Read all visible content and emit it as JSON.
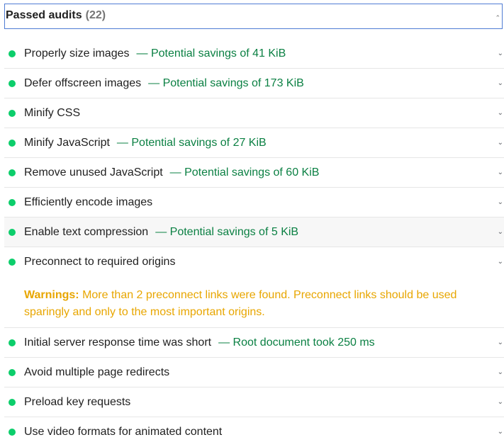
{
  "header": {
    "title": "Passed audits",
    "count": "(22)"
  },
  "audits": [
    {
      "label": "Properly size images",
      "savings": "— Potential savings of 41 KiB"
    },
    {
      "label": "Defer offscreen images",
      "savings": "— Potential savings of 173 KiB"
    },
    {
      "label": "Minify CSS",
      "savings": ""
    },
    {
      "label": "Minify JavaScript",
      "savings": "— Potential savings of 27 KiB"
    },
    {
      "label": "Remove unused JavaScript",
      "savings": "— Potential savings of 60 KiB"
    },
    {
      "label": "Efficiently encode images",
      "savings": ""
    },
    {
      "label": "Enable text compression",
      "savings": "— Potential savings of 5 KiB"
    },
    {
      "label": "Preconnect to required origins",
      "savings": "",
      "warning_label": "Warnings:",
      "warning_text": " More than 2 preconnect links were found. Preconnect links should be used sparingly and only to the most important origins."
    },
    {
      "label": "Initial server response time was short",
      "savings": "— Root document took 250 ms"
    },
    {
      "label": "Avoid multiple page redirects",
      "savings": ""
    },
    {
      "label": "Preload key requests",
      "savings": ""
    },
    {
      "label": "Use video formats for animated content",
      "savings": ""
    }
  ],
  "icons": {
    "pass": "pass-dot-icon",
    "expand": "chevron-down-icon",
    "collapse": "chevron-up-icon"
  },
  "colors": {
    "pass": "#0cce6b",
    "savings": "#0b8043",
    "warning": "#e8a600",
    "focus_border": "#4f7cd4"
  }
}
